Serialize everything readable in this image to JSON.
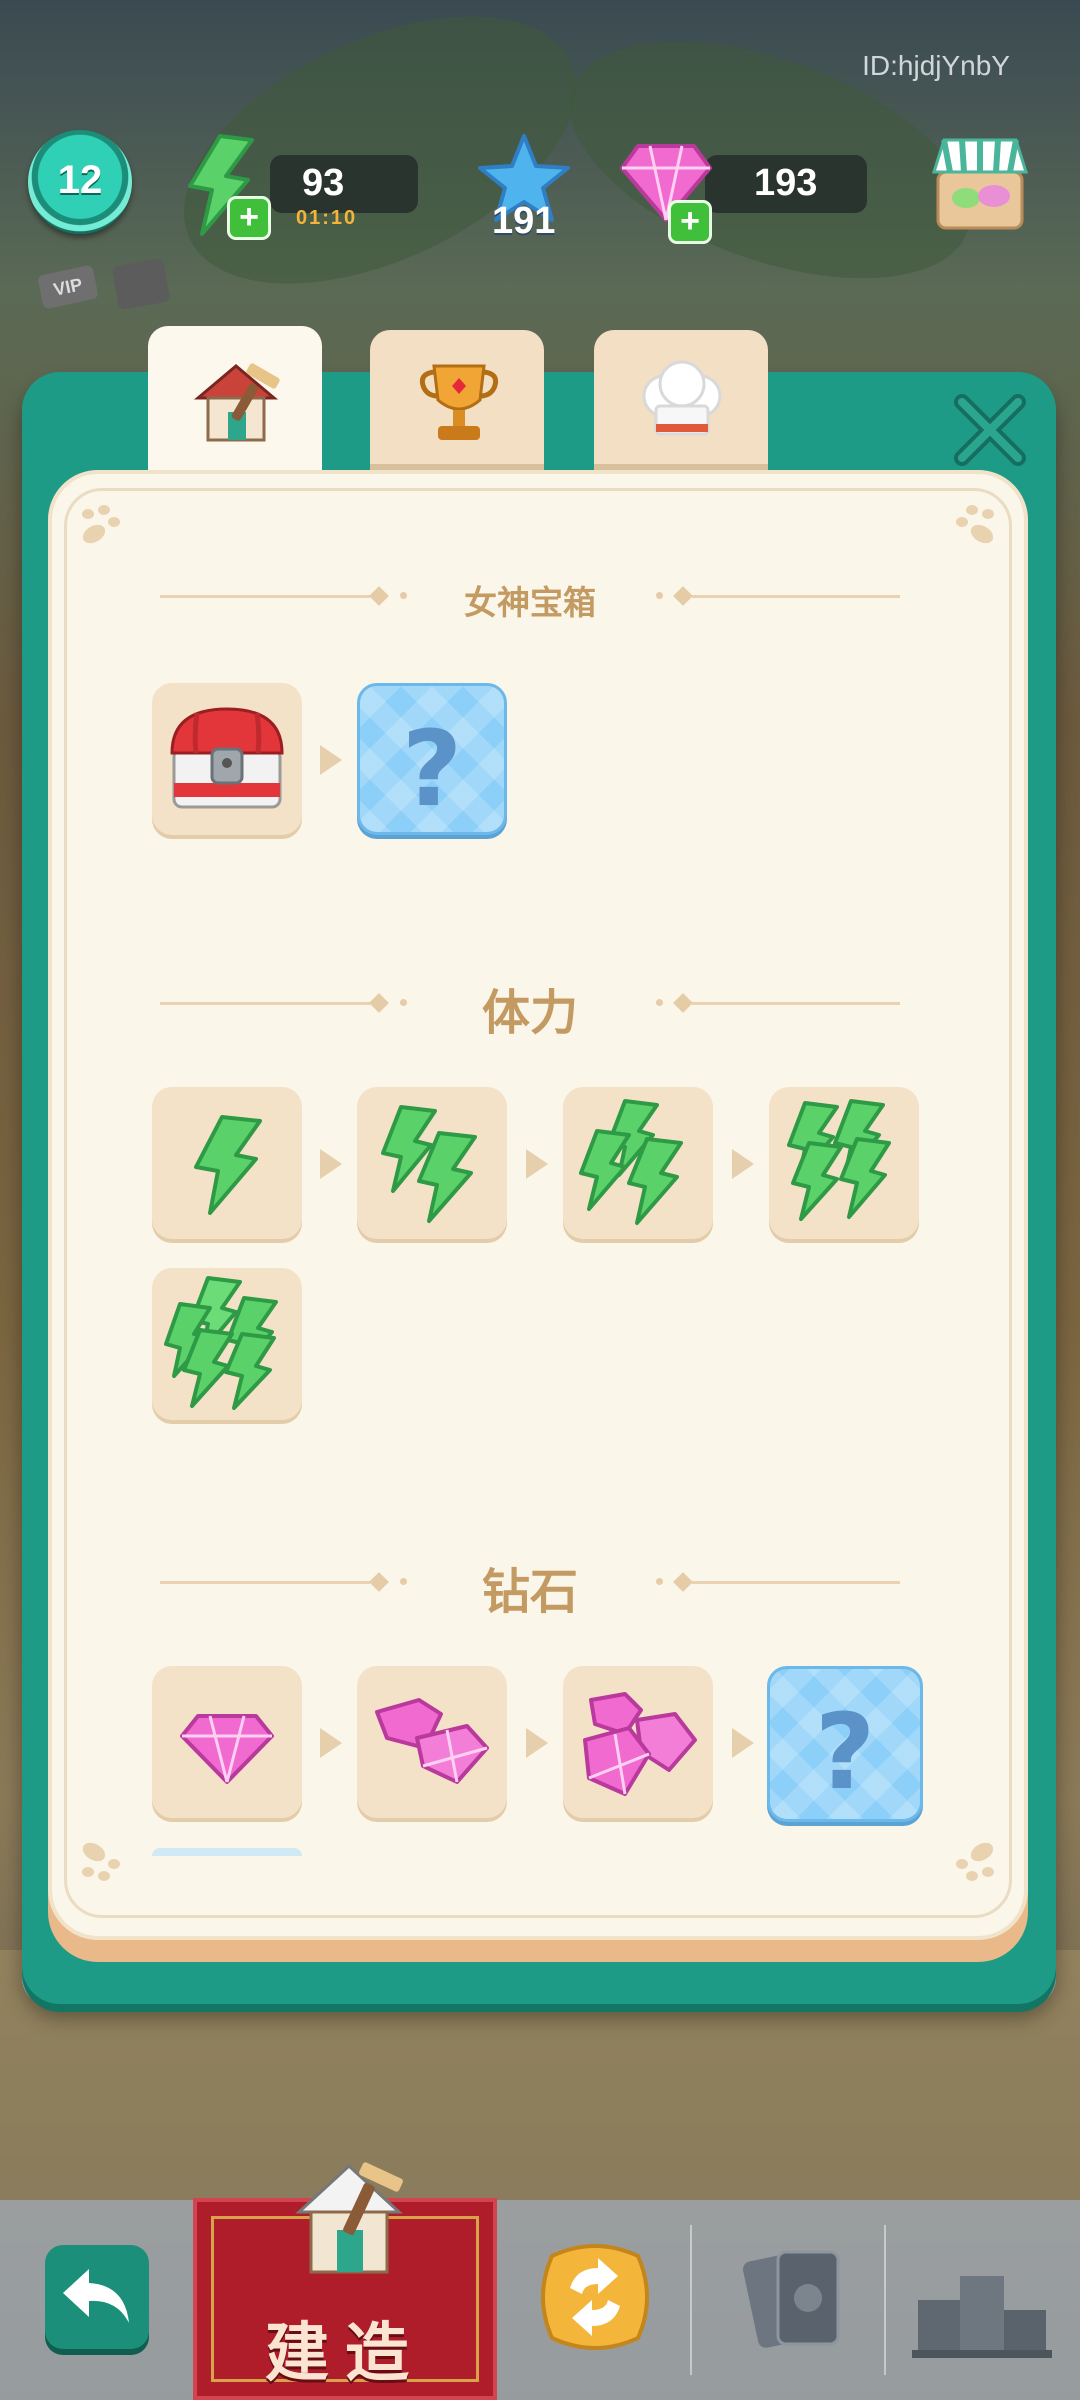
{
  "hud": {
    "player_id": "ID:hjdjYnbY",
    "level": "12",
    "energy": "93",
    "energy_timer": "01:10",
    "stars": "191",
    "gems": "193",
    "vip_label": "VIP"
  },
  "tabs": [
    {
      "name": "build",
      "icon": "house-icon",
      "active": true
    },
    {
      "name": "trophy",
      "icon": "trophy-icon",
      "active": false
    },
    {
      "name": "chef",
      "icon": "chef-hat-icon",
      "active": false
    }
  ],
  "sections": {
    "goddess_chest": {
      "title": "女神宝箱",
      "items": [
        "treasure-chest-icon",
        "mystery-icon"
      ]
    },
    "energy": {
      "title": "体力",
      "items": [
        "energy-1-icon",
        "energy-2-icon",
        "energy-3-icon",
        "energy-4-icon",
        "energy-5-icon"
      ]
    },
    "gems": {
      "title": "钻石",
      "items": [
        "gem-1-icon",
        "gem-2-icon",
        "gem-3-icon",
        "mystery-icon"
      ]
    }
  },
  "bottom_bar": {
    "build_label": "建造"
  },
  "colors": {
    "panel_teal": "#1e9b86",
    "card_bg": "#fbf6ea",
    "section_title": "#c39a62",
    "tile_bg": "#f4e2c8",
    "mystery_blue": "#8ccff8",
    "build_red": "#b01d2a"
  }
}
